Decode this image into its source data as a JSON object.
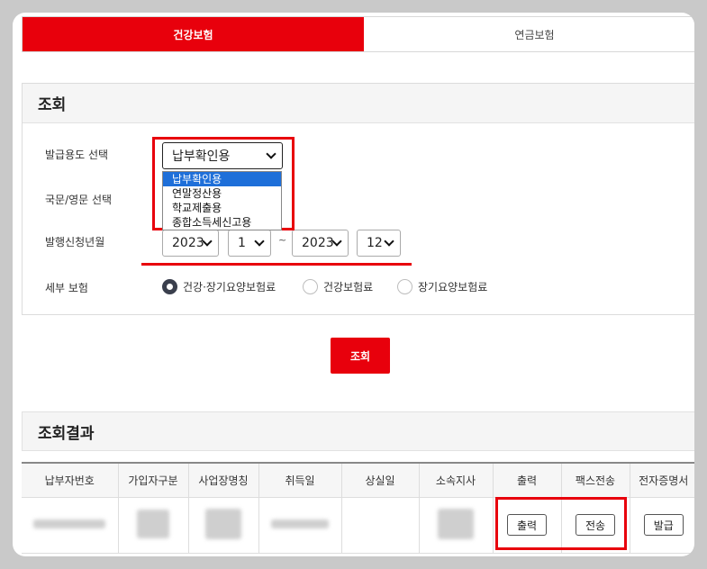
{
  "tabs": [
    {
      "label": "건강보험",
      "active": true
    },
    {
      "label": "연금보험",
      "active": false
    }
  ],
  "search": {
    "title": "조회",
    "purpose_label": "발급용도 선택",
    "purpose_value": "납부확인용",
    "purpose_options": [
      "납부확인용",
      "연말정산용",
      "학교제출용",
      "종합소득세신고용"
    ],
    "language_label": "국문/영문 선택",
    "period_label": "발행신청년월",
    "from_year": "2023",
    "from_month": "1",
    "separator": "~",
    "to_year": "2023",
    "to_month": "12",
    "detail_label": "세부 보험",
    "detail_options": [
      {
        "label": "건강·장기요양보험료",
        "checked": true
      },
      {
        "label": "건강보험료",
        "checked": false
      },
      {
        "label": "장기요양보험료",
        "checked": false
      }
    ],
    "button": "조회"
  },
  "results": {
    "title": "조회결과",
    "columns": [
      "납부자번호",
      "가입자구분",
      "사업장명칭",
      "취득일",
      "상실일",
      "소속지사",
      "출력",
      "팩스전송",
      "전자증명서"
    ],
    "row_buttons": {
      "print": "출력",
      "fax": "전송",
      "issue": "발급"
    }
  },
  "colors": {
    "accent": "#e8000c",
    "highlight": "#1e6fd9"
  }
}
